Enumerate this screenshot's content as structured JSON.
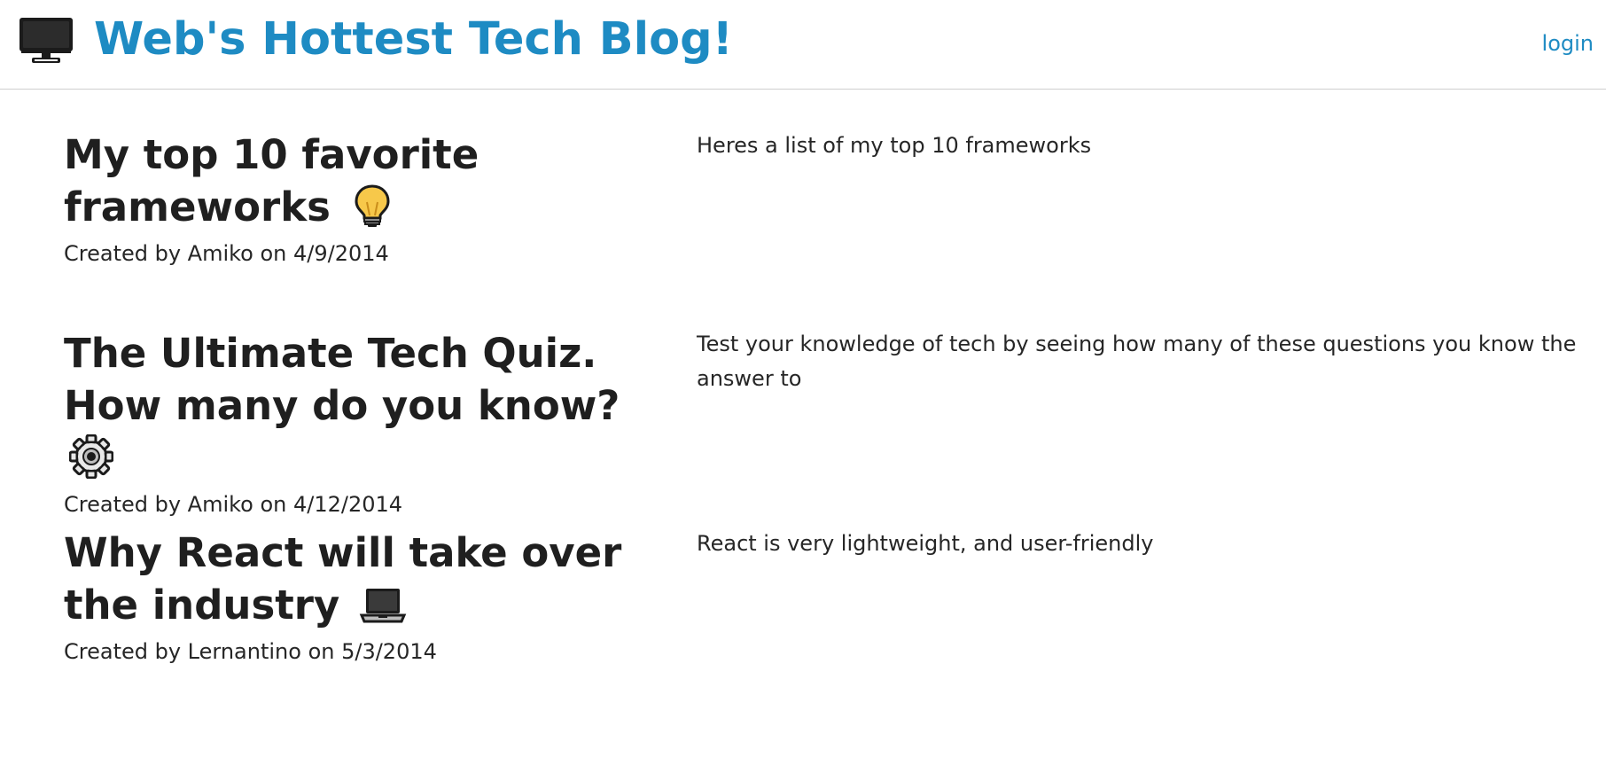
{
  "header": {
    "title": "Web's Hottest Tech Blog!",
    "brand_icon": "desktop-computer-icon",
    "login_label": "login",
    "accent_color": "#1e8bc3"
  },
  "posts": [
    {
      "title": "My top 10 favorite frameworks",
      "icon": "light-bulb-icon",
      "meta": "Created by Amiko on 4/9/2014",
      "body": "Heres a list of my top 10 frameworks"
    },
    {
      "title": "The Ultimate Tech Quiz. How many do you know?",
      "icon": "gear-icon",
      "meta": "Created by Amiko on 4/12/2014",
      "body": "Test your knowledge of tech by seeing how many of these questions you know the answer to"
    },
    {
      "title": "Why React will take over the industry",
      "icon": "laptop-icon",
      "meta": "Created by Lernantino on 5/3/2014",
      "body": "React is very lightweight, and user-friendly"
    }
  ]
}
